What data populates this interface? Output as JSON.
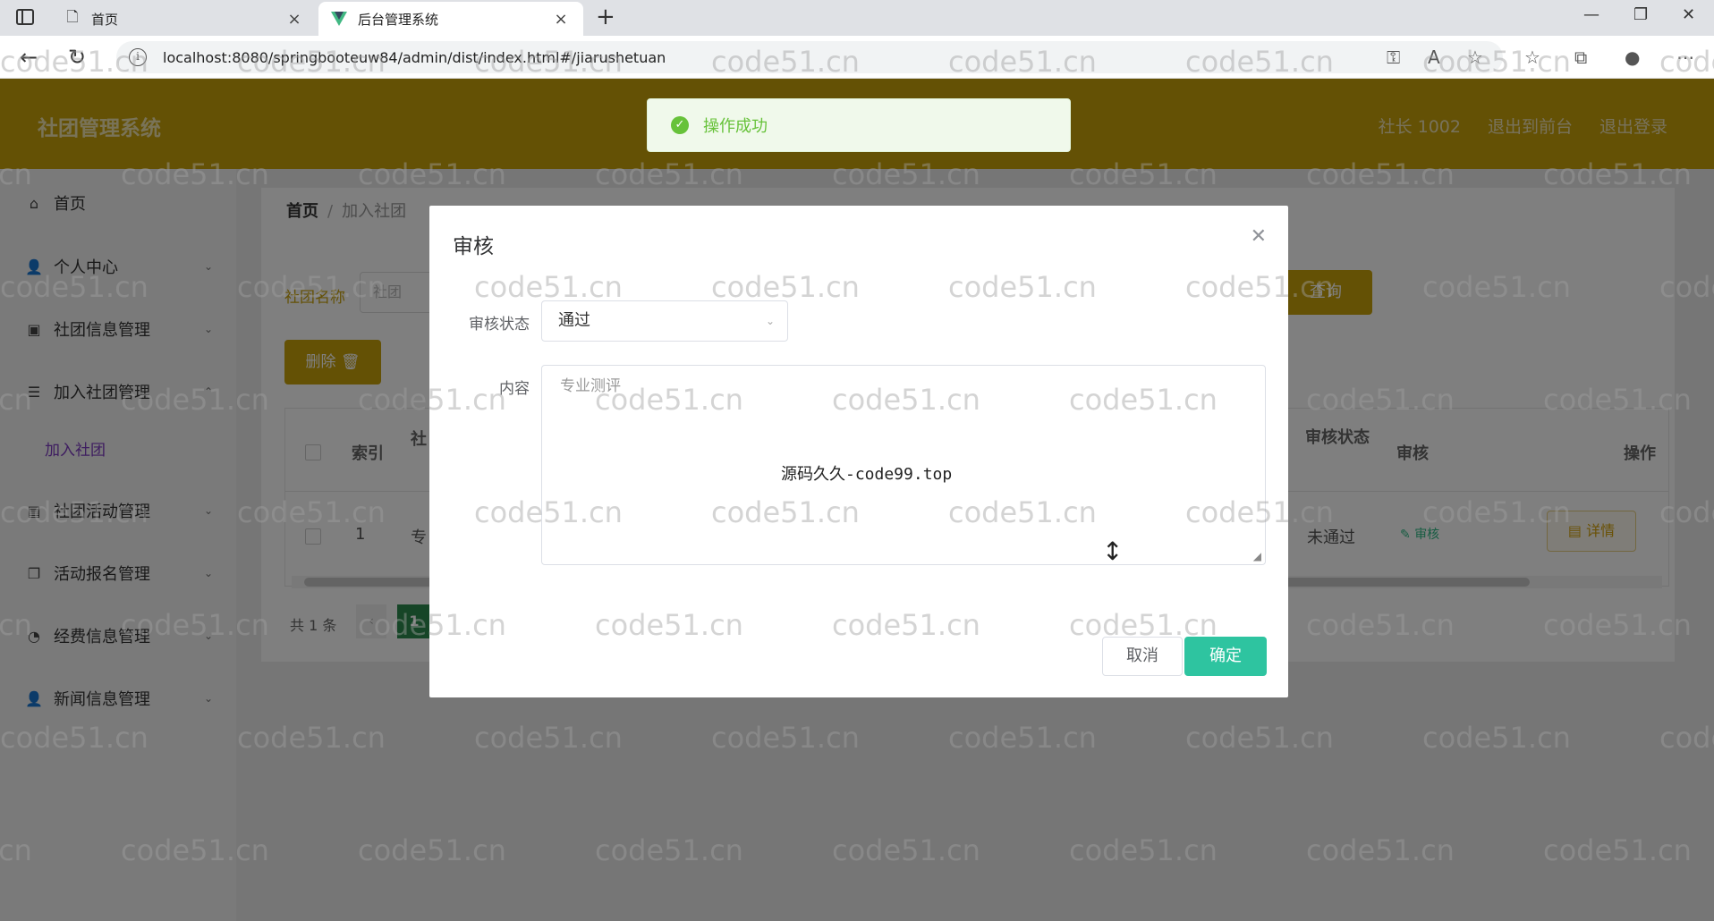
{
  "browser": {
    "tabs": [
      {
        "title": "首页",
        "active": false
      },
      {
        "title": "后台管理系统",
        "active": true
      }
    ],
    "url": "localhost:8080/springbooteuw84/admin/dist/index.html#/jiarushetuan"
  },
  "header": {
    "title": "社团管理系统",
    "links": [
      "社长 1002",
      "退出到前台",
      "退出登录"
    ],
    "color": "#c9a20a"
  },
  "sidebar": {
    "items": [
      {
        "label": "首页",
        "icon": "home-icon"
      },
      {
        "label": "个人中心",
        "icon": "user-icon"
      },
      {
        "label": "社团信息管理",
        "icon": "clipboard-icon"
      },
      {
        "label": "加入社团管理",
        "icon": "list-icon"
      },
      {
        "label": "社团活动管理",
        "icon": "document-icon"
      },
      {
        "label": "活动报名管理",
        "icon": "copy-icon"
      },
      {
        "label": "经费信息管理",
        "icon": "gauge-icon"
      },
      {
        "label": "新闻信息管理",
        "icon": "person-icon"
      }
    ],
    "active_sub": "加入社团"
  },
  "main": {
    "breadcrumb": [
      "首页",
      "加入社团"
    ],
    "search_label": "社团名称",
    "search_placeholder": "社团",
    "query_label": "查询",
    "delete_label": "删除",
    "table": {
      "headers": [
        "索引",
        "社",
        "审核状态",
        "审核",
        "操作"
      ],
      "row": {
        "index": "1",
        "name": "专",
        "status": "未通过",
        "review": "审核",
        "detail": "详情"
      }
    },
    "pager": {
      "total": "共 1 条",
      "page": "1"
    }
  },
  "toast": {
    "message": "操作成功",
    "type": "success"
  },
  "dialog": {
    "title": "审核",
    "status_label": "审核状态",
    "status_value": "通过",
    "content_label": "内容",
    "content_placeholder": "专业测评",
    "overlay_text": "源码久久-code99.top",
    "cancel_label": "取消",
    "confirm_label": "确定",
    "confirm_color": "#2ec4a0"
  },
  "watermark": "code51.cn"
}
